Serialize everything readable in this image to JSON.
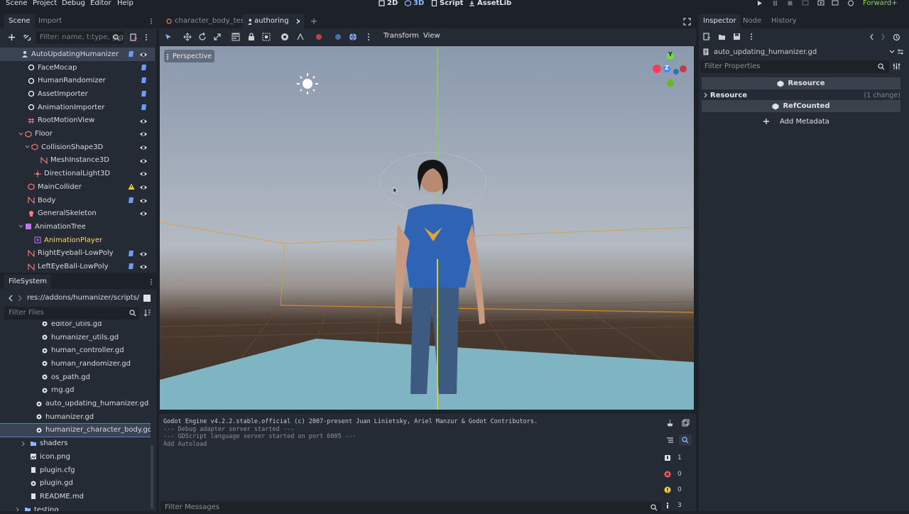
{
  "menu": [
    "Scene",
    "Project",
    "Debug",
    "Editor",
    "Help"
  ],
  "modes": [
    {
      "label": "2D",
      "active": false
    },
    {
      "label": "3D",
      "active": true
    },
    {
      "label": "Script",
      "active": false
    },
    {
      "label": "AssetLib",
      "active": false
    }
  ],
  "renderer": "Forward+",
  "scene_dock": {
    "tabs": [
      "Scene",
      "Import"
    ],
    "filter_placeholder": "Filter: name, t:type, g:gr",
    "nodes": [
      {
        "name": "AutoUpdatingHumanizer",
        "indent": 0,
        "icon": "person-icon",
        "selected": true,
        "script": true,
        "visible": true
      },
      {
        "name": "FaceMocap",
        "indent": 1,
        "icon": "node-circle-icon",
        "script": true
      },
      {
        "name": "HumanRandomizer",
        "indent": 1,
        "icon": "node-circle-icon",
        "script": true
      },
      {
        "name": "AssetImporter",
        "indent": 1,
        "icon": "node-circle-icon",
        "script": true
      },
      {
        "name": "AnimationImporter",
        "indent": 1,
        "icon": "node-circle-icon",
        "script": true
      },
      {
        "name": "RootMotionView",
        "indent": 1,
        "icon": "hash-icon",
        "visible": true
      },
      {
        "name": "Floor",
        "indent": 1,
        "icon": "cube-icon",
        "visible": true,
        "collapse": true
      },
      {
        "name": "CollisionShape3D",
        "indent": 2,
        "icon": "cube-icon",
        "visible": true,
        "collapse": true
      },
      {
        "name": "MeshInstance3D",
        "indent": 3,
        "icon": "mesh-icon",
        "visible": true
      },
      {
        "name": "DirectionalLight3D",
        "indent": 2,
        "icon": "light-icon",
        "visible": true
      },
      {
        "name": "MainCollider",
        "indent": 1,
        "icon": "cube-icon",
        "warning": true,
        "visible": true
      },
      {
        "name": "Body",
        "indent": 1,
        "icon": "mesh-icon",
        "script": true,
        "visible": true
      },
      {
        "name": "GeneralSkeleton",
        "indent": 1,
        "icon": "skeleton-icon",
        "visible": true
      },
      {
        "name": "AnimationTree",
        "indent": 1,
        "icon": "animtree-icon",
        "collapse": true
      },
      {
        "name": "AnimationPlayer",
        "indent": 2,
        "icon": "animplayer-icon",
        "highlight": true
      },
      {
        "name": "RightEyeball-LowPoly",
        "indent": 1,
        "icon": "mesh-icon",
        "script": true,
        "visible": true
      },
      {
        "name": "LeftEyeBall-LowPoly",
        "indent": 1,
        "icon": "mesh-icon",
        "script": true,
        "visible": true
      }
    ]
  },
  "filesystem": {
    "title": "FileSystem",
    "path": "res://addons/humanizer/scripts/hu",
    "filter_placeholder": "Filter Files",
    "items": [
      {
        "name": "editor_utils.gd",
        "indent": 3,
        "type": "gd"
      },
      {
        "name": "humanizer_utils.gd",
        "indent": 3,
        "type": "gd"
      },
      {
        "name": "human_controller.gd",
        "indent": 3,
        "type": "gd"
      },
      {
        "name": "human_randomizer.gd",
        "indent": 3,
        "type": "gd"
      },
      {
        "name": "os_path.gd",
        "indent": 3,
        "type": "gd"
      },
      {
        "name": "rng.gd",
        "indent": 3,
        "type": "gd"
      },
      {
        "name": "auto_updating_humanizer.gd",
        "indent": 2,
        "type": "gd"
      },
      {
        "name": "humanizer.gd",
        "indent": 2,
        "type": "gd"
      },
      {
        "name": "humanizer_character_body.gd",
        "indent": 2,
        "type": "gd",
        "selected": true
      },
      {
        "name": "shaders",
        "indent": 1,
        "type": "folder"
      },
      {
        "name": "icon.png",
        "indent": 1,
        "type": "image"
      },
      {
        "name": "plugin.cfg",
        "indent": 1,
        "type": "file"
      },
      {
        "name": "plugin.gd",
        "indent": 1,
        "type": "gd"
      },
      {
        "name": "README.md",
        "indent": 1,
        "type": "file"
      },
      {
        "name": "testing",
        "indent": 0,
        "type": "folder"
      }
    ]
  },
  "editor_tabs": [
    {
      "label": "character_body_test",
      "active": false
    },
    {
      "label": "authoring",
      "active": true
    }
  ],
  "viewport": {
    "toolbar_menus": [
      "Transform",
      "View"
    ],
    "perspective_label": "Perspective",
    "gizmo": {
      "y": "Y",
      "z": "Z"
    }
  },
  "console": {
    "lines": [
      "Godot Engine v4.2.2.stable.official (c) 2007-present Juan Linietsky, Ariel Manzur & Godot Contributors.",
      "--- Debug adapter server started ---",
      "--- GDScript language server started on port 6005 ---",
      "Add Autoload"
    ],
    "filter_placeholder": "Filter Messages",
    "counts": {
      "messages": "1",
      "errors": "0",
      "warnings": "0",
      "info": "3"
    }
  },
  "inspector": {
    "tabs": [
      "Inspector",
      "Node",
      "History"
    ],
    "resource_name": "auto_updating_humanizer.gd",
    "filter_placeholder": "Filter Properties",
    "section_resource": "Resource",
    "resource_row": "Resource",
    "resource_change": "(1 change)",
    "section_refcounted": "RefCounted",
    "add_metadata": "Add Metadata"
  },
  "colors": {
    "accent": "#8eb8ff",
    "warning": "#ffcc33",
    "error": "#ff5d5d",
    "script": "#6b9dff"
  }
}
